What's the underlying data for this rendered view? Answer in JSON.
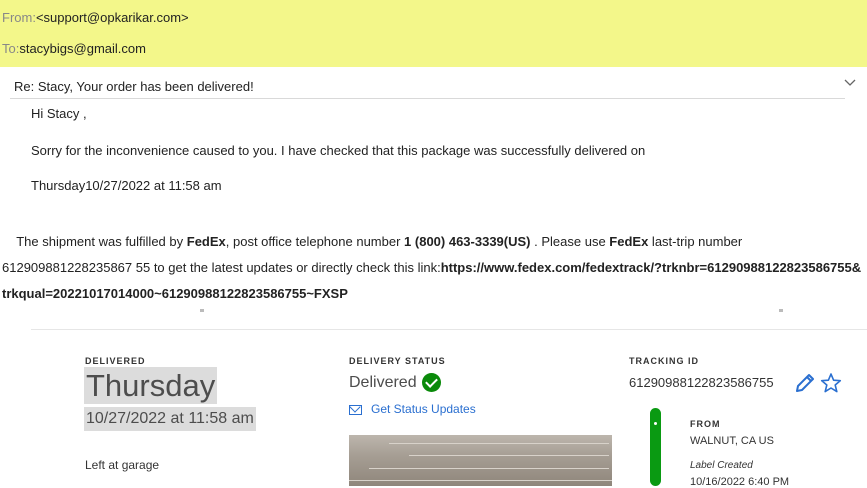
{
  "email": {
    "from_label": "From:",
    "from_value": "<support@opkarikar.com>",
    "to_label": "To:",
    "to_value": "stacybigs@gmail.com",
    "subject": "Re: Stacy, Your order has been delivered!",
    "greeting": "Hi Stacy  ,",
    "line1": "Sorry for the inconvenience caused to you. I have checked that this package was successfully delivered on",
    "line2": "Thursday10/27/2022 at 11:58 am",
    "ship_part1": "    The shipment was fulfilled by ",
    "ship_carrier1": "FedEx",
    "ship_part2": ", post office telephone number ",
    "ship_phone": "1 (800) 463-3339(US)",
    "ship_part3": " . Please use ",
    "ship_carrier2": "FedEx",
    "ship_part4": " last-trip number 612909881228235867 55 to get the latest updates or directly check this link:",
    "ship_link": "https://www.fedex.com/fedextrack/?trknbr=61290988122823586755&trkqual=20221017014000~61290988122823586755~FXSP"
  },
  "tracking": {
    "delivered_label": "DELIVERED",
    "delivered_day": "Thursday",
    "delivered_date": "10/27/2022 at 11:58 am",
    "left_at": "Left at garage",
    "status_label": "DELIVERY STATUS",
    "status_value": "Delivered",
    "get_updates": "Get Status Updates",
    "tracking_label": "TRACKING ID",
    "tracking_id": "61290988122823586755",
    "from_label": "FROM",
    "from_value": "WALNUT, CA US",
    "label_created": "Label Created",
    "label_date": "10/16/2022 6:40 PM"
  },
  "colors": {
    "header_bg": "#f3f78a",
    "link_blue": "#2a6fd0",
    "delivered_green": "#0a8a0a"
  },
  "icons": [
    "chevron-down-icon",
    "check-circle-icon",
    "envelope-icon",
    "pencil-icon",
    "star-icon"
  ]
}
